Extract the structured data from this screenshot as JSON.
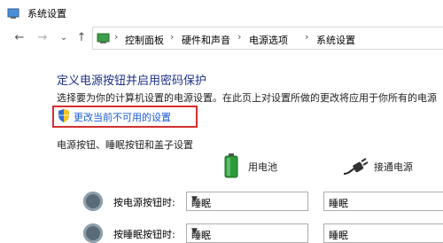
{
  "window": {
    "title": "系统设置"
  },
  "nav": {
    "back": "←",
    "forward": "→",
    "recent": "⌄",
    "up": "↑"
  },
  "breadcrumb": {
    "items": [
      "控制面板",
      "硬件和声音",
      "电源选项",
      "系统设置"
    ],
    "separator": "›"
  },
  "main": {
    "heading": "定义电源按钮并启用密码保护",
    "description": "选择要为你的计算机设置的电源设置。在此页上对设置所做的更改将应用于你所有的电源",
    "change_link": "更改当前不可用的设置",
    "section_title": "电源按钮、睡眠按钮和盖子设置",
    "columns": {
      "battery": "用电池",
      "ac": "接通电源"
    },
    "rows": [
      {
        "label": "按电源按钮时:",
        "battery_value": "睡眠",
        "ac_value": "睡眠"
      },
      {
        "label": "按睡眠按钮时:",
        "battery_value": "睡眠",
        "ac_value": "睡眠"
      }
    ]
  },
  "colors": {
    "heading": "#1e3287",
    "link": "#1a5bd4",
    "highlight_box": "#d32f2f"
  }
}
